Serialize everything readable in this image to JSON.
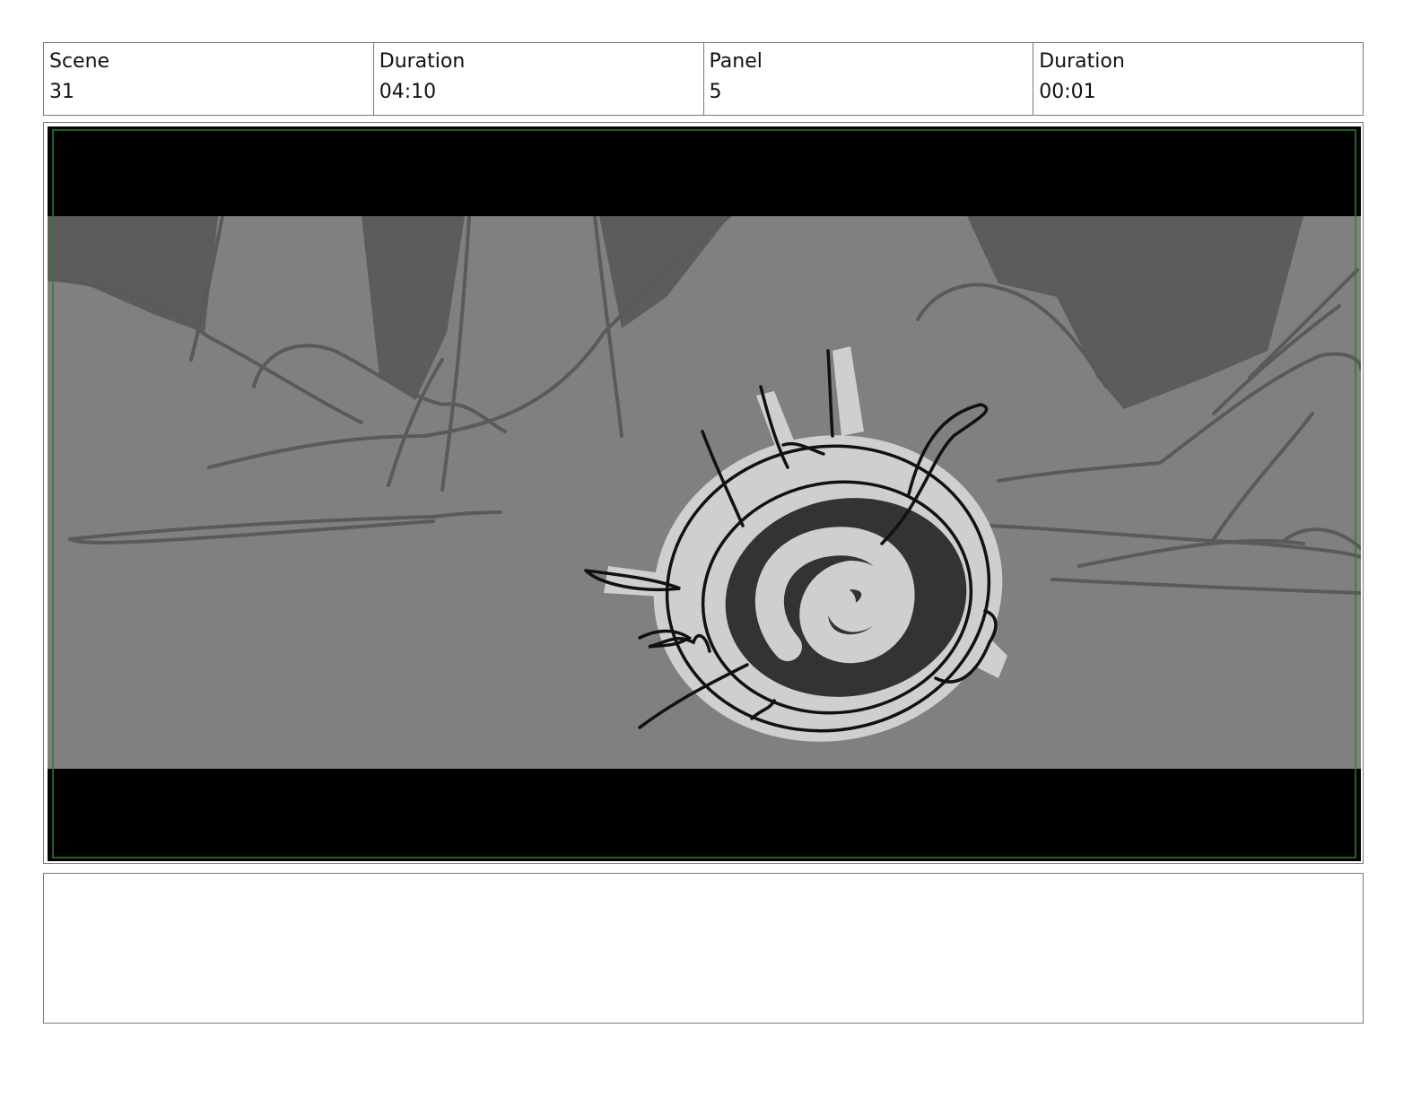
{
  "header": {
    "scene_label": "Scene",
    "scene_value": "31",
    "scene_duration_label": "Duration",
    "scene_duration_value": "04:10",
    "panel_label": "Panel",
    "panel_value": "5",
    "panel_duration_label": "Duration",
    "panel_duration_value": "00:01"
  },
  "panel": {
    "colors": {
      "letterbox": "#000000",
      "background": "#808080",
      "shadow": "#5c5c5c",
      "highlight": "#cfcfcf",
      "dark": "#333333",
      "safe_frame": "#2e7d32"
    }
  },
  "notes": {
    "text": ""
  }
}
